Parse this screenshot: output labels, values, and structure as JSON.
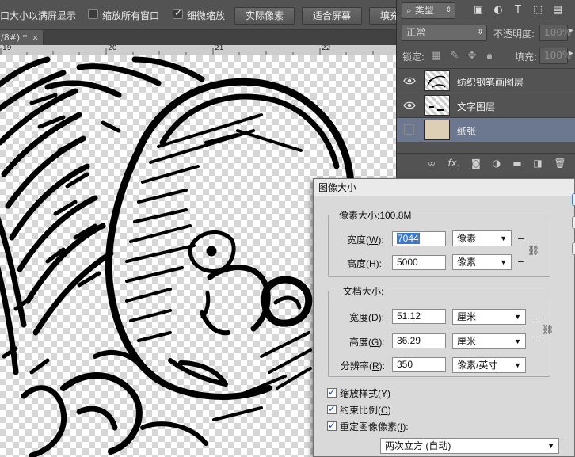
{
  "options_bar": {
    "resize_windows_label": "口大小以满屏显示",
    "zoom_all_windows_label": "缩放所有窗口",
    "zoom_all_windows_checked": false,
    "scrubby_zoom_label": "细微缩放",
    "scrubby_zoom_checked": true,
    "actual_pixels_button": "实际像素",
    "fit_screen_button": "适合屏幕",
    "fill_screen_button": "填充"
  },
  "document_tab": {
    "title": "/8#) *",
    "close": "×"
  },
  "ruler": {
    "labels": [
      "19",
      "20",
      "21",
      "22"
    ]
  },
  "layers_panel": {
    "filter_label": "类型",
    "blend_mode": "正常",
    "opacity_label": "不透明度:",
    "opacity_value": "100%",
    "lock_label": "锁定:",
    "fill_label": "填充:",
    "fill_value": "100%",
    "layers": [
      {
        "name": "纺织钢笔画图层",
        "visible": true,
        "selected": false
      },
      {
        "name": "文字图层",
        "visible": true,
        "selected": false
      },
      {
        "name": "纸张",
        "visible": false,
        "selected": true
      }
    ],
    "bottom_icons": [
      "link-icon",
      "fx-icon",
      "mask-icon",
      "adjustment-icon",
      "folder-icon",
      "new-layer-icon",
      "trash-icon"
    ],
    "fx_label": "fx."
  },
  "dialog": {
    "title": "图像大小",
    "pixel_dimensions": {
      "legend": "像素大小:100.8M",
      "width_label": "宽度(",
      "width_key": "W",
      "width_value": "7044",
      "width_unit": "像素",
      "height_label": "高度(",
      "height_key": "H",
      "height_value": "5000",
      "height_unit": "像素"
    },
    "document_size": {
      "legend": "文档大小:",
      "width_label": "宽度(",
      "width_key": "D",
      "width_value": "51.12",
      "width_unit": "厘米",
      "height_label": "高度(",
      "height_key": "G",
      "height_value": "36.29",
      "height_unit": "厘米",
      "resolution_label": "分辨率(",
      "resolution_key": "R",
      "resolution_value": "350",
      "resolution_unit": "像素/英寸"
    },
    "scale_styles_label": "缩放样式(",
    "scale_styles_key": "Y",
    "scale_styles_checked": true,
    "constrain_label": "约束比例(",
    "constrain_key": "C",
    "constrain_checked": true,
    "resample_label": "重定图像像素(",
    "resample_key": "I",
    "resample_checked": true,
    "resample_method": "两次立方 (自动)",
    "label_close": "):",
    "label_close_simple": ")"
  }
}
